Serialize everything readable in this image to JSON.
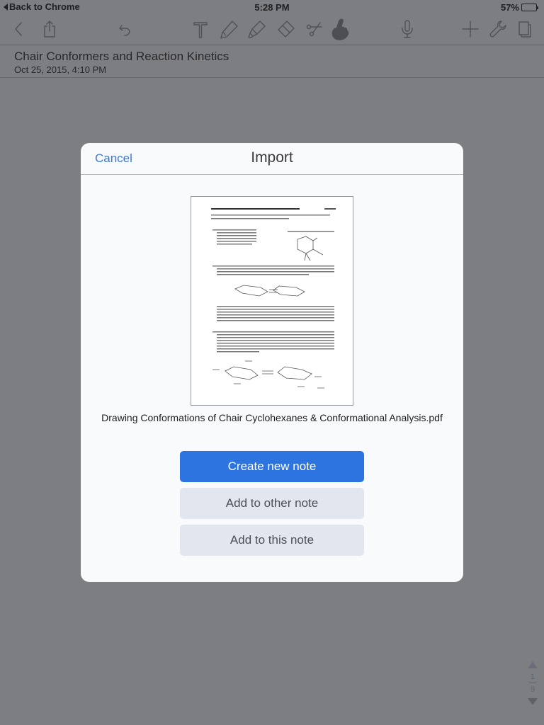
{
  "status_bar": {
    "back_label": "Back to Chrome",
    "time": "5:28 PM",
    "battery_percent_label": "57%",
    "battery_level": 0.57
  },
  "toolbar": {
    "icons": [
      "back-chevron-icon",
      "share-icon",
      "undo-icon",
      "text-tool-icon",
      "pen-icon",
      "highlighter-icon",
      "eraser-icon",
      "scissors-icon",
      "hand-pointer-icon",
      "microphone-icon",
      "add-icon",
      "wrench-icon",
      "pages-icon"
    ],
    "active_tool": "hand-pointer-icon"
  },
  "note": {
    "title": "Chair Conformers and Reaction Kinetics",
    "date": "Oct 25, 2015, 4:10 PM"
  },
  "page_nav": {
    "current": "1",
    "total": "9"
  },
  "dialog": {
    "title": "Import",
    "cancel_label": "Cancel",
    "filename": "Drawing Conformations of Chair Cyclohexanes & Conformational Analysis.pdf",
    "thumbnail": {
      "heading": "Drawing Conformers of Cyclohexanes and Conformational Analysis"
    },
    "buttons": {
      "create_new": "Create new note",
      "add_other": "Add to other note",
      "add_this": "Add to this note"
    }
  },
  "colors": {
    "accent": "#2e74e0",
    "link": "#3a7ad6",
    "secondary_button": "#e2e6ef",
    "dimmed_background": "#7d7e82"
  }
}
